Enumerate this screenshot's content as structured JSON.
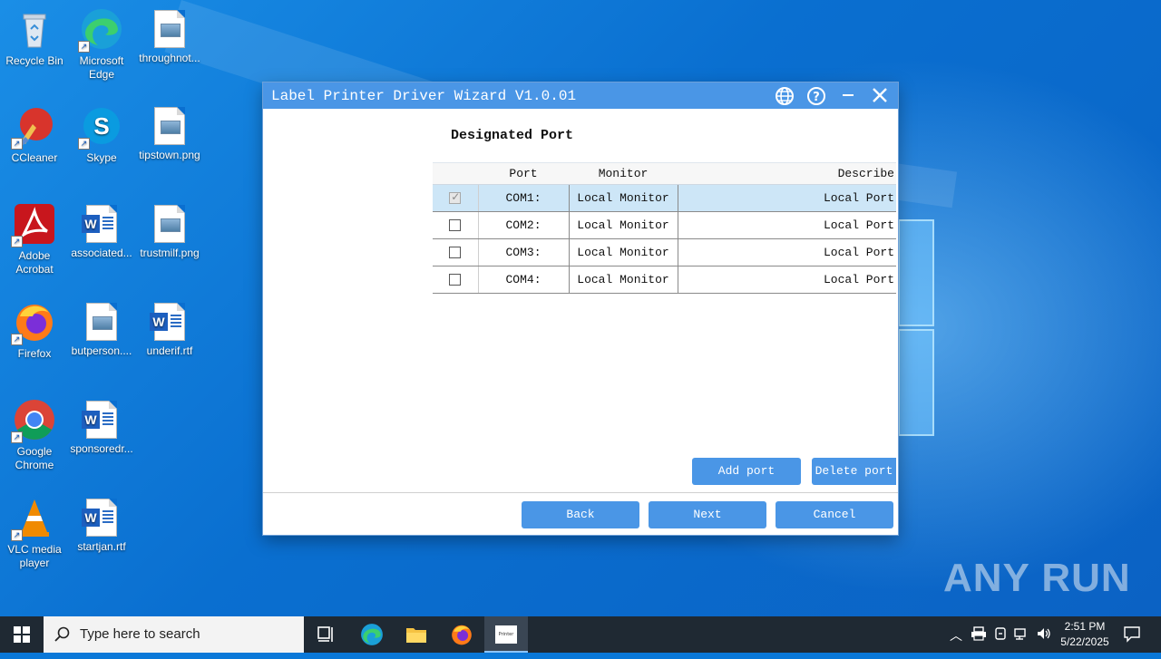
{
  "desktop": {
    "icons": [
      {
        "label": "Recycle Bin",
        "icon": "recycle-bin-icon"
      },
      {
        "label": "Microsoft Edge",
        "icon": "edge-icon"
      },
      {
        "label": "throughnot...",
        "icon": "image-file-icon"
      },
      {
        "label": "CCleaner",
        "icon": "ccleaner-icon"
      },
      {
        "label": "Skype",
        "icon": "skype-icon"
      },
      {
        "label": "tipstown.png",
        "icon": "image-file-icon"
      },
      {
        "label": "Adobe Acrobat",
        "icon": "acrobat-icon"
      },
      {
        "label": "associated...",
        "icon": "word-doc-icon"
      },
      {
        "label": "trustmilf.png",
        "icon": "image-file-icon"
      },
      {
        "label": "Firefox",
        "icon": "firefox-icon"
      },
      {
        "label": "butperson....",
        "icon": "image-file-icon"
      },
      {
        "label": "underif.rtf",
        "icon": "word-doc-icon"
      },
      {
        "label": "Google Chrome",
        "icon": "chrome-icon"
      },
      {
        "label": "sponsoredr...",
        "icon": "word-doc-icon"
      },
      {
        "label": "VLC media player",
        "icon": "vlc-icon"
      },
      {
        "label": "startjan.rtf",
        "icon": "word-doc-icon"
      }
    ]
  },
  "dialog": {
    "title": "Label Printer Driver Wizard  V1.0.01",
    "heading": "Designated Port",
    "columns": {
      "port": "Port",
      "monitor": "Monitor",
      "describe": "Describe"
    },
    "rows": [
      {
        "port": "COM1:",
        "monitor": "Local Monitor",
        "describe": "Local Port",
        "checked": true,
        "selected": true
      },
      {
        "port": "COM2:",
        "monitor": "Local Monitor",
        "describe": "Local Port",
        "checked": false,
        "selected": false
      },
      {
        "port": "COM3:",
        "monitor": "Local Monitor",
        "describe": "Local Port",
        "checked": false,
        "selected": false
      },
      {
        "port": "COM4:",
        "monitor": "Local Monitor",
        "describe": "Local Port",
        "checked": false,
        "selected": false
      }
    ],
    "buttons": {
      "add_port": "Add port",
      "delete_port": "Delete port",
      "back": "Back",
      "next": "Next",
      "cancel": "Cancel"
    },
    "accent": "#4a96e6"
  },
  "taskbar": {
    "search_placeholder": "Type here to search",
    "time": "2:51 PM",
    "date": "5/22/2025",
    "active_app_label": "Printer"
  },
  "watermark": "ANY RUN"
}
